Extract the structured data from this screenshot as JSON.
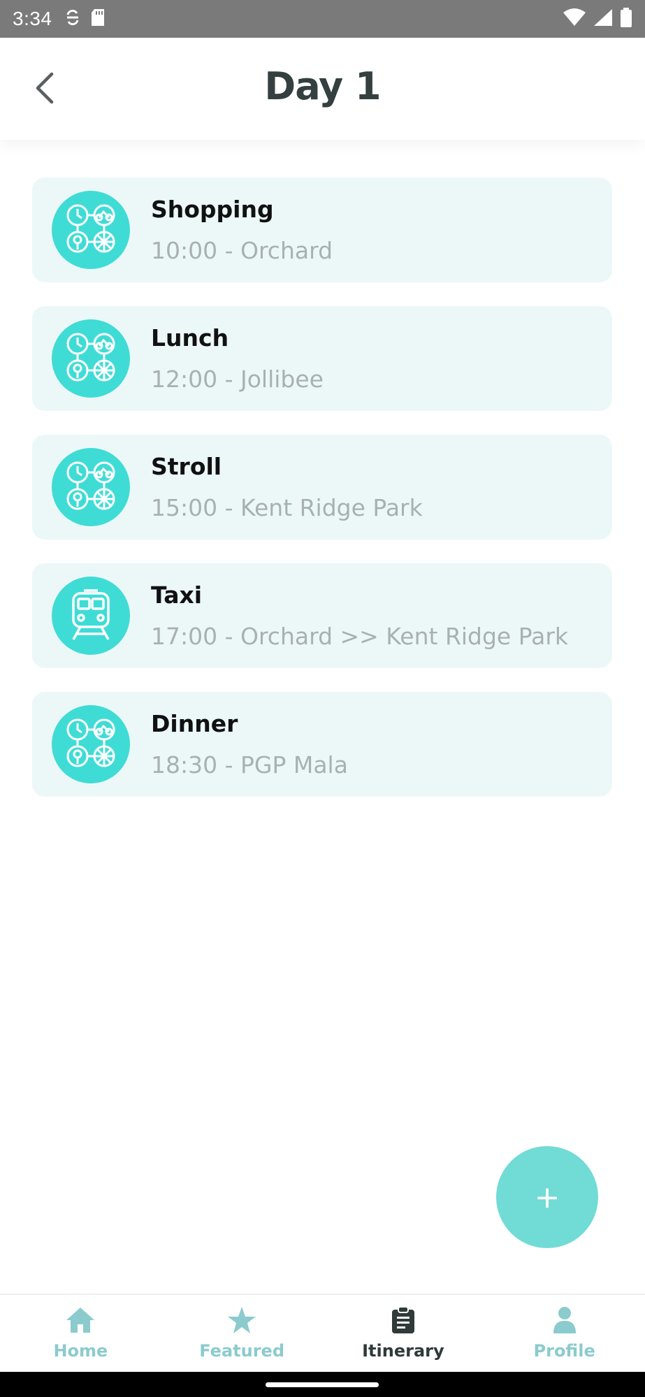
{
  "status_bar": {
    "time": "3:34",
    "left_icons": [
      "sync-icon",
      "sd-card-icon"
    ],
    "right_icons": [
      "wifi-icon",
      "signal-icon",
      "battery-icon"
    ]
  },
  "header": {
    "title": "Day 1",
    "back_icon": "chevron-left-icon"
  },
  "activities": [
    {
      "title": "Shopping",
      "subtitle": "10:00 - Orchard",
      "icon": "activities-icon"
    },
    {
      "title": "Lunch",
      "subtitle": "12:00 - Jollibee",
      "icon": "activities-icon"
    },
    {
      "title": "Stroll",
      "subtitle": "15:00 - Kent Ridge Park",
      "icon": "activities-icon"
    },
    {
      "title": "Taxi",
      "subtitle": "17:00 - Orchard >> Kent Ridge Park",
      "icon": "train-icon"
    },
    {
      "title": "Dinner",
      "subtitle": "18:30 - PGP Mala",
      "icon": "activities-icon"
    }
  ],
  "fab": {
    "label": "+"
  },
  "bottom_nav": {
    "items": [
      {
        "label": "Home",
        "icon": "home-icon",
        "active": false
      },
      {
        "label": "Featured",
        "icon": "star-icon",
        "active": false
      },
      {
        "label": "Itinerary",
        "icon": "clipboard-icon",
        "active": true
      },
      {
        "label": "Profile",
        "icon": "person-icon",
        "active": false
      }
    ]
  },
  "colors": {
    "accent": "#3fdcd6",
    "fab": "#71dbd6",
    "card_bg": "#ecf8f8",
    "nav_inactive": "#8ccbcd",
    "nav_active": "#2f3a39",
    "title": "#33403f",
    "subtitle": "#a9b0b0"
  }
}
